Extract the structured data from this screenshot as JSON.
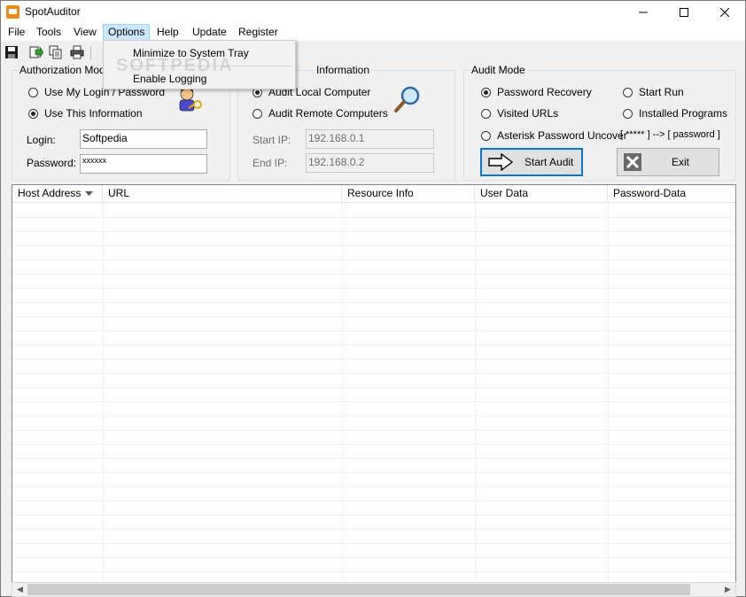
{
  "window": {
    "title": "SpotAuditor",
    "icon": "app-icon",
    "controls": [
      "minimize-icon",
      "maximize-icon",
      "close-icon"
    ]
  },
  "menubar": {
    "items": [
      {
        "label": "File"
      },
      {
        "label": "Tools"
      },
      {
        "label": "View"
      },
      {
        "label": "Options",
        "active": true
      },
      {
        "label": "Help"
      },
      {
        "label": "Update"
      },
      {
        "label": "Register"
      }
    ]
  },
  "toolbar": {
    "buttons": [
      "save-icon",
      "export-icon",
      "copy-icon",
      "print-icon"
    ]
  },
  "options_menu": {
    "items": [
      {
        "label": "Minimize to System Tray"
      },
      {
        "label": "Enable Logging"
      }
    ]
  },
  "watermark": "SOFTPEDIA",
  "auth": {
    "legend": "Authorization Mode",
    "use_my_login": "Use My Login / Password",
    "use_this_info": "Use This Information",
    "selected": "use_this_info",
    "login_label": "Login:",
    "login_value": "Softpedia",
    "password_label": "Password:",
    "password_value": "xxxxxx"
  },
  "info": {
    "legend": "Information",
    "audit_local": "Audit Local Computer",
    "audit_remote": "Audit Remote Computers",
    "selected": "audit_local",
    "start_ip_label": "Start IP:",
    "start_ip_value": "192.168.0.1",
    "end_ip_label": "End IP:",
    "end_ip_value": "192.168.0.2"
  },
  "audit_mode": {
    "legend": "Audit Mode",
    "password_recovery": "Password Recovery",
    "visited_urls": "Visited URLs",
    "asterisk_uncover": "Asterisk Password Uncover",
    "start_run": "Start Run",
    "installed_programs": "Installed Programs",
    "asterisk_hint": "[ ***** ] --> [ password ]",
    "selected": "password_recovery",
    "start_button": "Start Audit",
    "exit_button": "Exit"
  },
  "table": {
    "columns": [
      "Host Address",
      "URL",
      "Resource Info",
      "User Data",
      "Password-Data"
    ],
    "sort_indicator": "chevron-down-icon",
    "rows": []
  },
  "colors": {
    "accent": "#0078d7",
    "menu_highlight": "#cce8ff",
    "app_icon": "#f08a1c"
  }
}
